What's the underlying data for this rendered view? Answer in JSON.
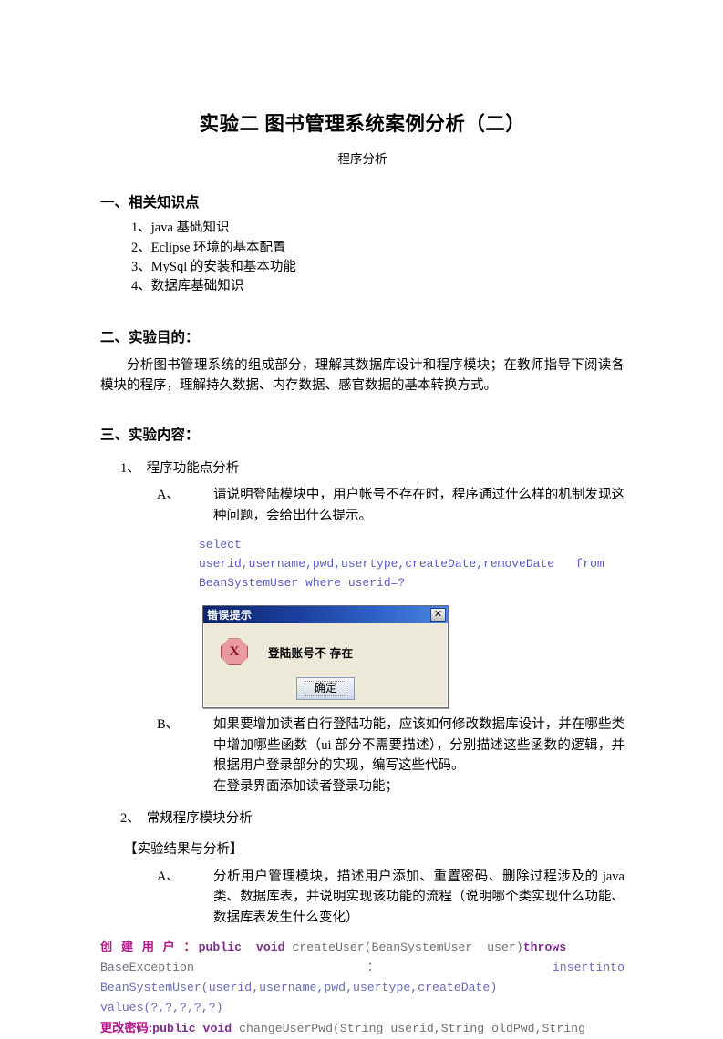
{
  "document": {
    "title": "实验二  图书管理系统案例分析（二）",
    "subtitle": "程序分析"
  },
  "section_one": {
    "heading": "一、相关知识点",
    "items": [
      "1、java 基础知识",
      "2、Eclipse 环境的基本配置",
      "3、MySql 的安装和基本功能",
      "4、数据库基础知识"
    ]
  },
  "section_two": {
    "heading": "二、实验目的：",
    "paragraph": "分析图书管理系统的组成部分，理解其数据库设计和程序模块；在教师指导下阅读各模块的程序，理解持久数据、内存数据、感官数据的基本转换方式。"
  },
  "section_three": {
    "heading": "三、实验内容：",
    "item1": {
      "num": "1、",
      "label": "程序功能点分析",
      "sub_a": {
        "marker": "A、",
        "text": "请说明登陆模块中，用户帐号不存在时，程序通过什么样的机制发现这种问题，会给出什么提示。"
      },
      "sql_code": {
        "line1": "select",
        "line2": "userid,username,pwd,usertype,createDate,removeDate   from",
        "line3": "BeanSystemUser where userid=?"
      },
      "sub_b": {
        "marker": "B、",
        "text": "如果要增加读者自行登陆功能，应该如何修改数据库设计，并在哪些类中增加哪些函数（ui 部分不需要描述），分别描述这些函数的逻辑，并根据用户登录部分的实现，编写这些代码。",
        "text2": "在登录界面添加读者登录功能；"
      }
    },
    "item2": {
      "num": "2、",
      "label": "常规程序模块分析",
      "bracket": "【实验结果与分析】",
      "sub_a": {
        "marker": "A、",
        "text": "分析用户管理模块，描述用户添加、重置密码、删除过程涉及的 java 类、数据库表，并说明实现该功能的流程（说明哪个类实现什么功能、数据库表发生什么变化）"
      }
    }
  },
  "code_bottom": {
    "line1_label": "创 建 用 户 ：",
    "line1_kw": "public  void",
    "line1_rest": " createUser(BeanSystemUser  user)",
    "line1_kw2": "throws",
    "line2_a": "BaseException",
    "line2_b": "：",
    "line2_c": "insert",
    "line2_d": "into",
    "line3": "BeanSystemUser(userid,username,pwd,usertype,createDate)",
    "line4": "values(?,?,?,?,?)",
    "line5_label": "更改密码:",
    "line5_kw": "public void",
    "line5_rest": " changeUserPwd(String userid,String oldPwd,String"
  },
  "error_dialog": {
    "title": "错误提示",
    "close_label": "✕",
    "icon_letter": "X",
    "message": "登陆账号不 存在",
    "ok_button": "确定"
  },
  "colors": {
    "code_blue": "#5b5bc4",
    "code_purple": "#6a6ab8",
    "keyword_purple": "#7b2d8e",
    "label_magenta": "#b5128a",
    "titlebar_blue": "#0a246a",
    "dialog_face": "#ece9d8",
    "error_icon": "#e89aa0"
  }
}
